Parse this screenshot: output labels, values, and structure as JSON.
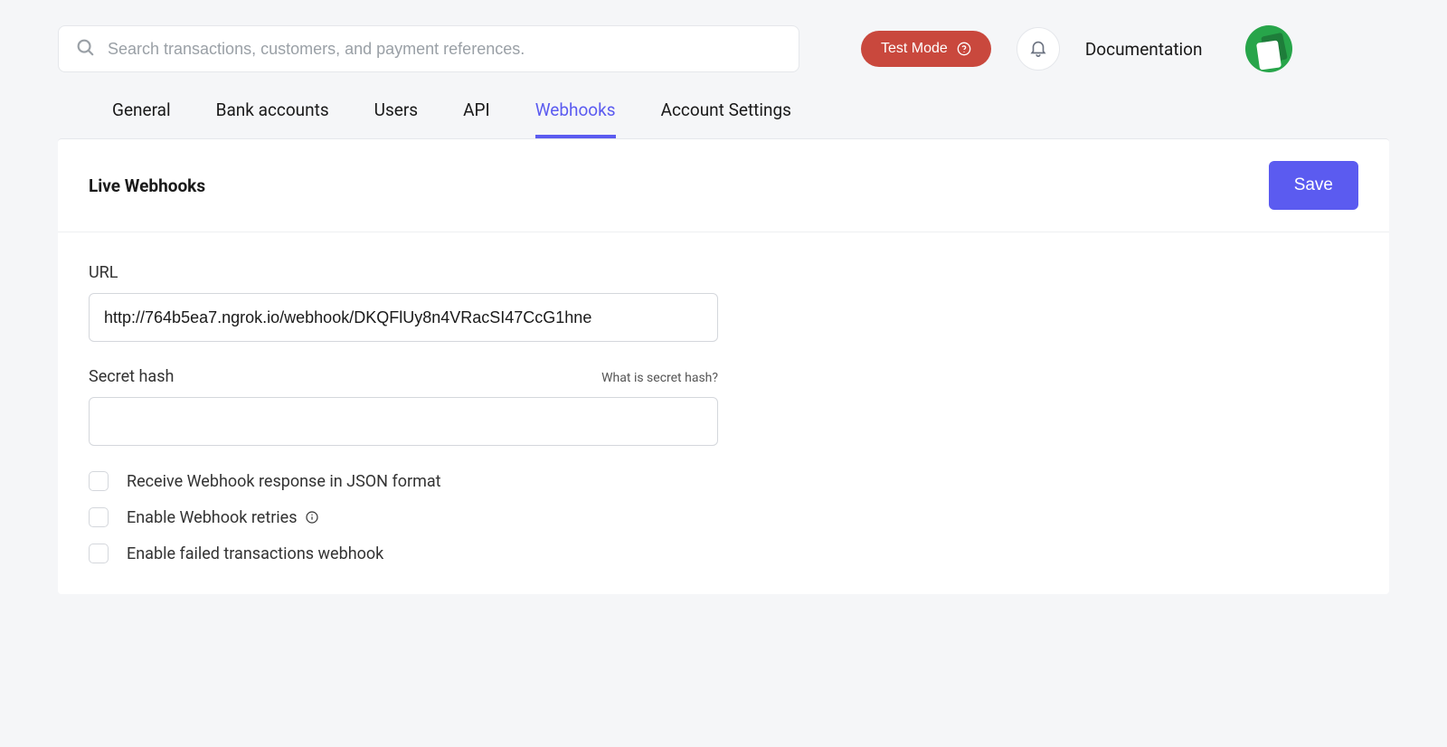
{
  "topbar": {
    "search_placeholder": "Search transactions, customers, and payment references.",
    "test_mode_label": "Test Mode",
    "documentation_label": "Documentation"
  },
  "tabs": [
    {
      "label": "General",
      "active": false
    },
    {
      "label": "Bank accounts",
      "active": false
    },
    {
      "label": "Users",
      "active": false
    },
    {
      "label": "API",
      "active": false
    },
    {
      "label": "Webhooks",
      "active": true
    },
    {
      "label": "Account Settings",
      "active": false
    }
  ],
  "panel": {
    "title": "Live Webhooks",
    "save_label": "Save",
    "url_label": "URL",
    "url_value": "http://764b5ea7.ngrok.io/webhook/DKQFlUy8n4VRacSI47CcG1hne",
    "secret_hash_label": "Secret hash",
    "secret_hash_help": "What is secret hash?",
    "secret_hash_value": "",
    "options": [
      {
        "label": "Receive Webhook response in JSON format",
        "info": false
      },
      {
        "label": "Enable Webhook retries",
        "info": true
      },
      {
        "label": "Enable failed transactions webhook",
        "info": false
      }
    ]
  }
}
